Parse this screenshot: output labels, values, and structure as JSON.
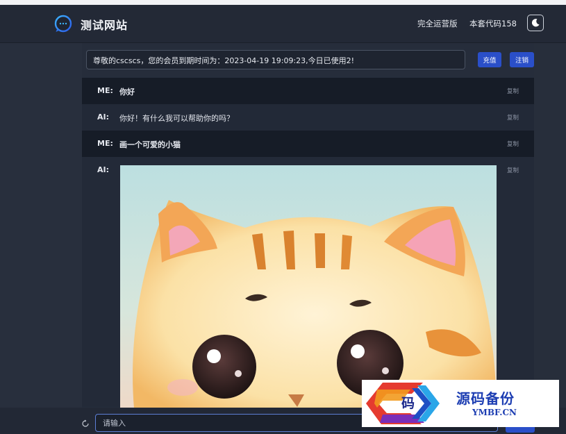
{
  "header": {
    "site_title": "测试网站",
    "nav": [
      "完全运营版",
      "本套代码158"
    ]
  },
  "notice": {
    "text": "尊敬的cscscs，您的会员到期时间为：2023-04-19 19:09:23,今日已使用2!"
  },
  "buttons": {
    "recharge": "充值",
    "logout": "注销"
  },
  "messages": [
    {
      "role": "ME:",
      "text": "你好",
      "copy": "复制"
    },
    {
      "role": "AI:",
      "text": "你好！有什么我可以帮助你的吗？",
      "copy": "复制"
    },
    {
      "role": "ME:",
      "text": "画一个可爱的小猫",
      "copy": "复制"
    },
    {
      "role": "AI:",
      "text": "",
      "copy": "复制",
      "image": "cute-kitten-painting"
    }
  ],
  "input": {
    "placeholder": "请输入"
  },
  "watermark": {
    "char": "码",
    "text": "源码备份",
    "sub": "YMBF.CN"
  },
  "colors": {
    "accent": "#2a4fc9",
    "background": "#262d3b",
    "me_row": "#161c27",
    "ai_row": "#222937"
  }
}
